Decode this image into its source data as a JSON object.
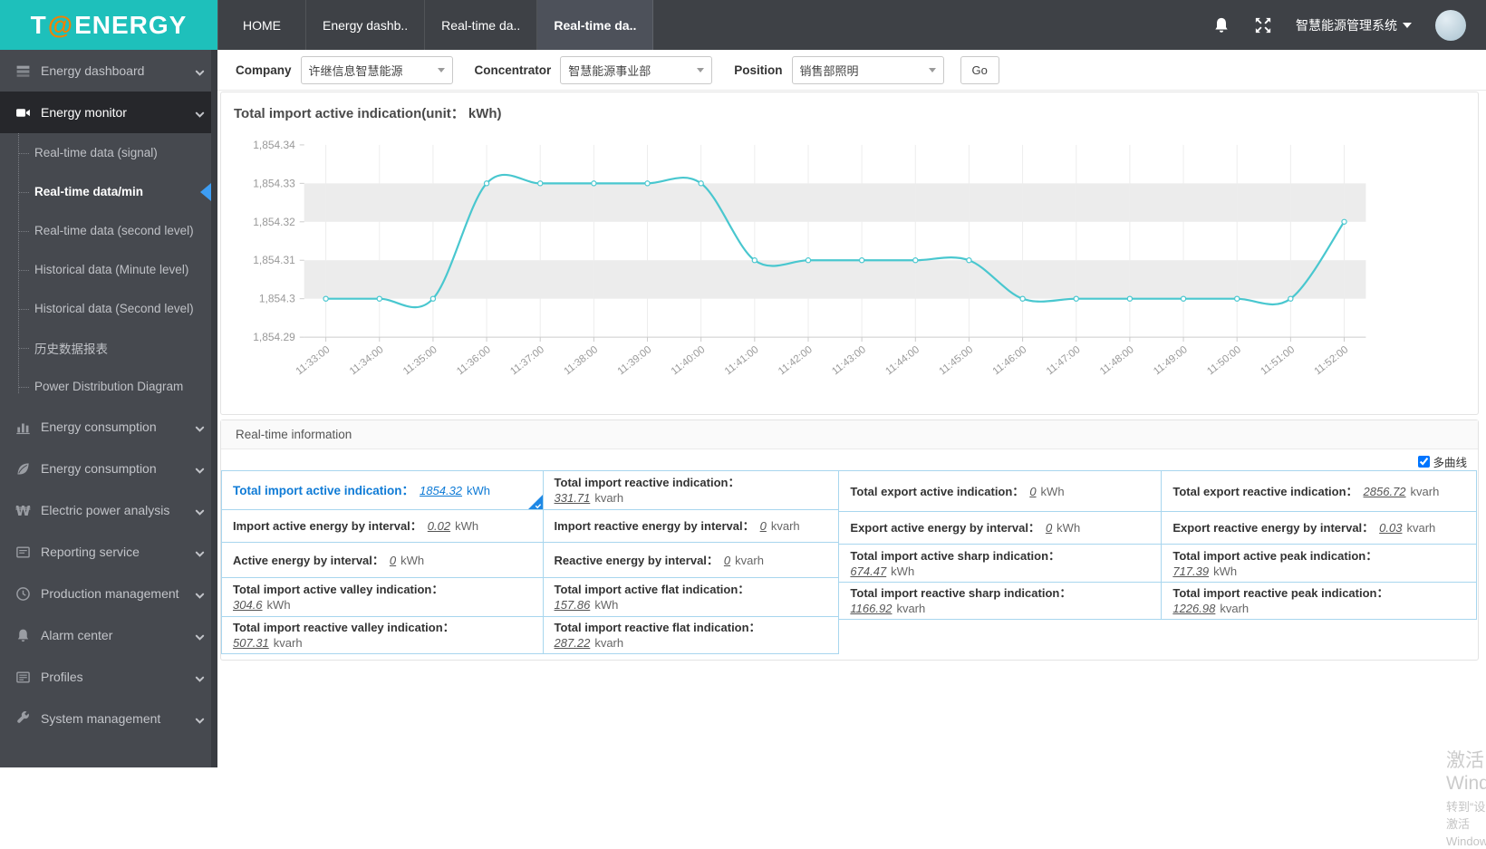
{
  "topbar": {
    "logo": {
      "prefix": "T",
      "at": "@",
      "suffix": "ENERGY"
    },
    "tabs": [
      {
        "label": "HOME",
        "active": false
      },
      {
        "label": "Energy dashb..",
        "active": false
      },
      {
        "label": "Real-time da..",
        "active": false
      },
      {
        "label": "Real-time da..",
        "active": true
      }
    ],
    "icons": [
      "bell-icon",
      "fullscreen-icon"
    ],
    "system_title": "智慧能源管理系统"
  },
  "sidebar": {
    "items": [
      {
        "label": "Energy dashboard",
        "icon": "dashboard-icon",
        "active": false
      },
      {
        "label": "Energy monitor",
        "icon": "camera-icon",
        "active": true,
        "children": [
          {
            "label": "Real-time data (signal)",
            "active": false
          },
          {
            "label": "Real-time data/min",
            "active": true
          },
          {
            "label": "Real-time data (second level)",
            "active": false
          },
          {
            "label": "Historical data (Minute level)",
            "active": false
          },
          {
            "label": "Historical data (Second level)",
            "active": false
          },
          {
            "label": "历史数据报表",
            "active": false
          },
          {
            "label": "Power Distribution Diagram",
            "active": false
          }
        ]
      },
      {
        "label": "Energy consumption",
        "icon": "bar-chart-icon",
        "active": false
      },
      {
        "label": "Energy consumption",
        "icon": "leaf-icon",
        "active": false
      },
      {
        "label": "Electric power analysis",
        "icon": "won-icon",
        "active": false
      },
      {
        "label": "Reporting service",
        "icon": "report-icon",
        "active": false
      },
      {
        "label": "Production management",
        "icon": "clock-icon",
        "active": false
      },
      {
        "label": "Alarm center",
        "icon": "alarm-bell-icon",
        "active": false
      },
      {
        "label": "Profiles",
        "icon": "profiles-icon",
        "active": false
      },
      {
        "label": "System management",
        "icon": "wrench-icon",
        "active": false
      }
    ]
  },
  "filters": {
    "company": {
      "label": "Company",
      "value": "许继信息智慧能源"
    },
    "concentrator": {
      "label": "Concentrator",
      "value": "智慧能源事业部"
    },
    "position": {
      "label": "Position",
      "value": "销售部照明"
    },
    "go_label": "Go"
  },
  "chart_data": {
    "type": "line",
    "title": "Total import active indication(unit： kWh)",
    "x": [
      "11:33:00",
      "11:34:00",
      "11:35:00",
      "11:36:00",
      "11:37:00",
      "11:38:00",
      "11:39:00",
      "11:40:00",
      "11:41:00",
      "11:42:00",
      "11:43:00",
      "11:44:00",
      "11:45:00",
      "11:46:00",
      "11:47:00",
      "11:48:00",
      "11:49:00",
      "11:50:00",
      "11:51:00",
      "11:52:00"
    ],
    "series": [
      {
        "name": "Total import active indication",
        "values": [
          1854.3,
          1854.3,
          1854.3,
          1854.33,
          1854.33,
          1854.33,
          1854.33,
          1854.33,
          1854.31,
          1854.31,
          1854.31,
          1854.31,
          1854.31,
          1854.3,
          1854.3,
          1854.3,
          1854.3,
          1854.3,
          1854.3,
          1854.32
        ]
      }
    ],
    "ylim": [
      1854.29,
      1854.34
    ],
    "y_ticks": [
      "1,854.34",
      "1,854.33",
      "1,854.32",
      "1,854.31",
      "1,854.3",
      "1,854.29"
    ],
    "line_color": "#49c7cf",
    "band_color": "#ececec",
    "grid": true,
    "legend_position": "none"
  },
  "realtime_panel": {
    "title": "Real-time information",
    "multi_curve_label": "多曲线",
    "multi_curve_checked": true,
    "columns": [
      {
        "cells": [
          {
            "label": "Total import active indication：",
            "value": "1854.32",
            "unit": "kWh",
            "highlight": true
          },
          {
            "label": "Import active energy by interval：",
            "value": "0.02",
            "unit": "kWh"
          },
          {
            "label": "Active energy by interval：",
            "value": "0",
            "unit": "kWh"
          },
          {
            "label": "Total import active valley indication：",
            "value": "304.6",
            "unit": "kWh",
            "wrap": true
          },
          {
            "label": "Total import reactive valley indication：",
            "value": "507.31",
            "unit": "kvarh",
            "wrap": true
          }
        ]
      },
      {
        "cells": [
          {
            "label": "Total import reactive indication：",
            "value": "331.71",
            "unit": "kvarh",
            "wrap": true
          },
          {
            "label": "Import reactive energy by interval：",
            "value": "0",
            "unit": "kvarh"
          },
          {
            "label": "Reactive energy by interval：",
            "value": "0",
            "unit": "kvarh"
          },
          {
            "label": "Total import active flat indication：",
            "value": "157.86",
            "unit": "kWh",
            "wrap": true
          },
          {
            "label": "Total import reactive flat indication：",
            "value": "287.22",
            "unit": "kvarh",
            "wrap": true
          }
        ]
      },
      {
        "cells": [
          {
            "label": "Total export active indication：",
            "value": "0",
            "unit": "kWh"
          },
          {
            "label": "Export active energy by interval：",
            "value": "0",
            "unit": "kWh"
          },
          {
            "label": "Total import active sharp indication：",
            "value": "674.47",
            "unit": "kWh",
            "wrap": true
          },
          {
            "label": "Total import reactive sharp indication：",
            "value": "1166.92",
            "unit": "kvarh",
            "wrap": true
          }
        ]
      },
      {
        "cells": [
          {
            "label": "Total export reactive indication：",
            "value": "2856.72",
            "unit": "kvarh"
          },
          {
            "label": "Export reactive energy by interval：",
            "value": "0.03",
            "unit": "kvarh"
          },
          {
            "label": "Total import active peak indication：",
            "value": "717.39",
            "unit": "kWh",
            "wrap": true
          },
          {
            "label": "Total import reactive peak indication：",
            "value": "1226.98",
            "unit": "kvarh",
            "wrap": true
          }
        ]
      }
    ]
  },
  "watermark": {
    "line1": "激活 Windows",
    "line2": "转到“设置”以激活 Windows。"
  }
}
